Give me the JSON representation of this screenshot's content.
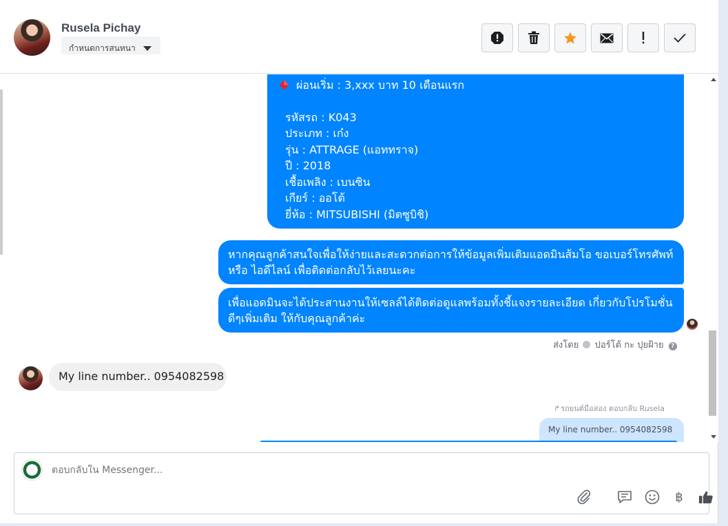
{
  "header": {
    "contact_name": "Rusela Pichay",
    "assign_label": "กำหนดการสนทนา",
    "toolbar_buttons": [
      {
        "icon": "alert-octagon-icon"
      },
      {
        "icon": "trash-icon"
      },
      {
        "icon": "star-icon",
        "color": "#f7931e"
      },
      {
        "icon": "envelope-icon"
      },
      {
        "icon": "exclamation-icon"
      },
      {
        "icon": "checkmark-icon"
      }
    ]
  },
  "messages": {
    "car_details": {
      "installment": "ผ่อนเริ่ม : 3,xxx บาท 10 เดือนแรก",
      "lines": [
        "รหัสรถ : K043",
        "ประเภท : เก๋ง",
        "รุ่น : ATTRAGE (แอททราจ)",
        "ปี : 2018",
        "เชื้อเพลิง : เบนซิน",
        "เกียร์ : ออโต้",
        "ยี่ห้อ : MITSUBISHI (มิตซูบิชิ)"
      ]
    },
    "contact_request": "หากคุณลูกค้าสนใจเพื่อให้ง่ายและสะดวกต่อการให้ข้อมูลเพิ่มเติมแอดมินส้มโอ ขอเบอร์โทรศัพท์ หรือ ไอดีไลน์ เพื่อติดต่อกลับไว้เลยนะคะ",
    "coordination": "เพื่อแอดมินจะได้ประสานงานให้เซลล์ได้ติดต่อดูแลพร้อมทั้งชี้แจงรายละเอียด เกี่ยวกับโปรโมชั่นดีๆเพิ่มเติม ให้กับคุณลูกค้าค่ะ",
    "sent_by_prefix": "ส่งโดย",
    "sent_by_name": "ปอร์โต้ กะ ปุยฝ้าย",
    "customer_reply": "My line number.. 0954082598",
    "reply_reference": "รถยนต์มือสอง ตอบกลับ Rusela",
    "quoted_reply": "My line number.. 0954082598"
  },
  "composer": {
    "placeholder": "ตอบกลับใน Messenger...",
    "icons": [
      "paperclip-icon",
      "quick-reply-icon",
      "emoji-icon",
      "baht-icon",
      "thumbs-up-icon"
    ],
    "baht_symbol": "฿"
  },
  "colors": {
    "accent": "#0084ff",
    "incoming_bubble": "#f1f0f0",
    "quoted_bubble": "#cde5ff"
  }
}
